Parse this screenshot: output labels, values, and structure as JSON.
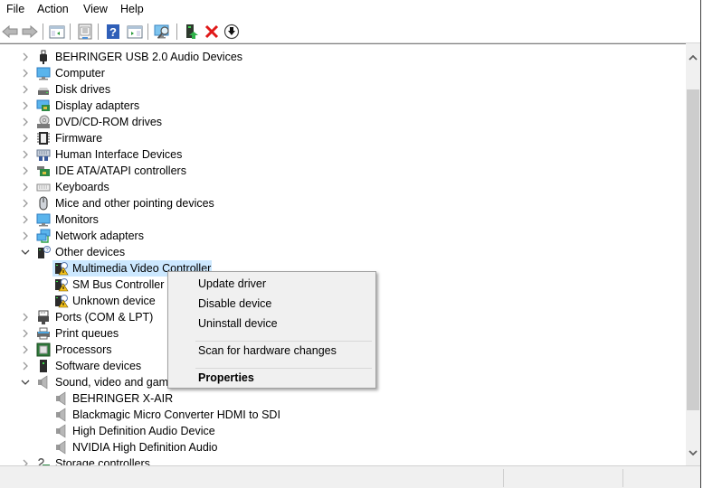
{
  "menu": [
    "File",
    "Action",
    "View",
    "Help"
  ],
  "toolbar": {
    "buttons": [
      "back-icon",
      "forward-icon",
      "show-hide-console-tree-icon",
      "properties-icon",
      "help-icon",
      "show-action-pane-icon",
      "scan-hardware-icon",
      "update-driver-icon",
      "uninstall-icon",
      "disable-device-icon"
    ]
  },
  "tree": {
    "items": [
      {
        "label": "BEHRINGER USB 2.0 Audio Devices",
        "icon": "usb-icon",
        "level": 0,
        "expanded": false
      },
      {
        "label": "Computer",
        "icon": "computer-icon",
        "level": 0,
        "expanded": false
      },
      {
        "label": "Disk drives",
        "icon": "disk-drive-icon",
        "level": 0,
        "expanded": false
      },
      {
        "label": "Display adapters",
        "icon": "display-adapter-icon",
        "level": 0,
        "expanded": false
      },
      {
        "label": "DVD/CD-ROM drives",
        "icon": "dvd-drive-icon",
        "level": 0,
        "expanded": false
      },
      {
        "label": "Firmware",
        "icon": "firmware-icon",
        "level": 0,
        "expanded": false
      },
      {
        "label": "Human Interface Devices",
        "icon": "hid-icon",
        "level": 0,
        "expanded": false
      },
      {
        "label": "IDE ATA/ATAPI controllers",
        "icon": "ide-controller-icon",
        "level": 0,
        "expanded": false
      },
      {
        "label": "Keyboards",
        "icon": "keyboard-icon",
        "level": 0,
        "expanded": false
      },
      {
        "label": "Mice and other pointing devices",
        "icon": "mouse-icon",
        "level": 0,
        "expanded": false
      },
      {
        "label": "Monitors",
        "icon": "monitor-icon",
        "level": 0,
        "expanded": false
      },
      {
        "label": "Network adapters",
        "icon": "network-adapter-icon",
        "level": 0,
        "expanded": false
      },
      {
        "label": "Other devices",
        "icon": "unknown-device-icon",
        "level": 0,
        "expanded": true
      },
      {
        "label": "Multimedia Video Controller",
        "icon": "warning-device-icon",
        "level": 1,
        "selected": true
      },
      {
        "label": "SM Bus Controller",
        "icon": "warning-device-icon",
        "level": 1
      },
      {
        "label": "Unknown device",
        "icon": "warning-device-icon",
        "level": 1
      },
      {
        "label": "Ports (COM & LPT)",
        "icon": "port-icon",
        "level": 0,
        "expanded": false
      },
      {
        "label": "Print queues",
        "icon": "printer-icon",
        "level": 0,
        "expanded": false
      },
      {
        "label": "Processors",
        "icon": "processor-icon",
        "level": 0,
        "expanded": false
      },
      {
        "label": "Software devices",
        "icon": "software-device-icon",
        "level": 0,
        "expanded": false
      },
      {
        "label": "Sound, video and game controllers",
        "icon": "speaker-icon",
        "level": 0,
        "expanded": true
      },
      {
        "label": "BEHRINGER X-AIR",
        "icon": "speaker-icon",
        "level": 1
      },
      {
        "label": "Blackmagic Micro Converter HDMI to SDI",
        "icon": "speaker-icon",
        "level": 1
      },
      {
        "label": "High Definition Audio Device",
        "icon": "speaker-icon",
        "level": 1
      },
      {
        "label": "NVIDIA High Definition Audio",
        "icon": "speaker-icon",
        "level": 1
      },
      {
        "label": "Storage controllers",
        "icon": "storage-controller-icon",
        "level": 0,
        "expanded": false
      }
    ]
  },
  "context_menu": {
    "items": [
      {
        "label": "Update driver"
      },
      {
        "label": "Disable device"
      },
      {
        "label": "Uninstall device"
      },
      {
        "separator": true
      },
      {
        "label": "Scan for hardware changes"
      },
      {
        "separator": true
      },
      {
        "label": "Properties",
        "bold": true
      }
    ]
  },
  "colors": {
    "selection": "#cce8ff",
    "menu_bg": "#f0f0f0",
    "status_bg": "#f0f0f0",
    "scroll_thumb": "#cdcdcd"
  }
}
